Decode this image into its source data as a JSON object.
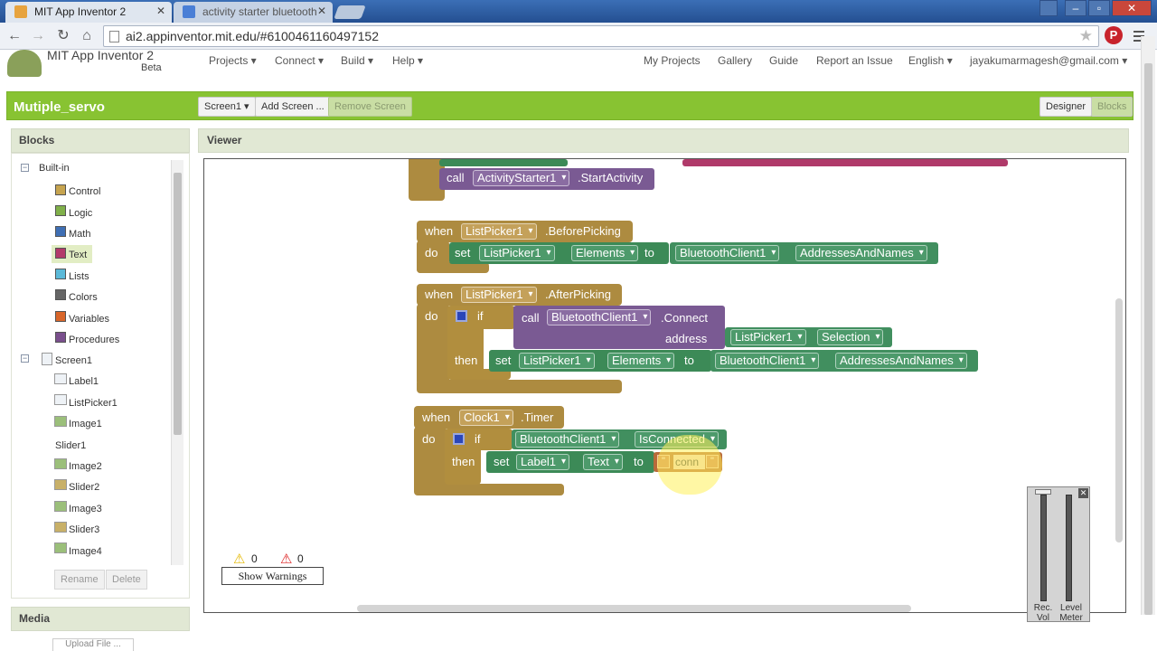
{
  "browser": {
    "tabs": [
      {
        "title": "MIT App Inventor 2",
        "active": true,
        "icon_color": "#e7a33e"
      },
      {
        "title": "activity starter bluetooth",
        "active": false,
        "icon_color": "#4a7fd6"
      }
    ],
    "url": "ai2.appinventor.mit.edu/#6100461160497152",
    "win_min": "–",
    "win_max": "▫",
    "win_close": "✕"
  },
  "app": {
    "title": "MIT App Inventor 2",
    "beta": "Beta",
    "menus": [
      "Projects ▾",
      "Connect ▾",
      "Build ▾",
      "Help ▾"
    ],
    "right_links": [
      "My Projects",
      "Gallery",
      "Guide",
      "Report an Issue",
      "English ▾",
      "jayakumarmagesh@gmail.com ▾"
    ]
  },
  "project": {
    "name": "Mutiple_servo",
    "screen_select": "Screen1 ▾",
    "add_screen": "Add Screen ...",
    "remove_screen": "Remove Screen",
    "designer": "Designer",
    "blocks": "Blocks"
  },
  "blocks_panel": {
    "title": "Blocks",
    "builtin_label": "Built-in",
    "builtin": [
      {
        "label": "Control",
        "color": "#c6a44f"
      },
      {
        "label": "Logic",
        "color": "#80b04a"
      },
      {
        "label": "Math",
        "color": "#3f6fb4"
      },
      {
        "label": "Text",
        "color": "#b33a6a"
      },
      {
        "label": "Lists",
        "color": "#5bb9d8"
      },
      {
        "label": "Colors",
        "color": "#666666"
      },
      {
        "label": "Variables",
        "color": "#d9662a"
      },
      {
        "label": "Procedures",
        "color": "#7a4f8d"
      }
    ],
    "screen_label": "Screen1",
    "components": [
      "Label1",
      "ListPicker1",
      "Image1",
      "Slider1",
      "Image2",
      "Slider2",
      "Image3",
      "Slider3",
      "Image4"
    ],
    "rename": "Rename",
    "delete": "Delete",
    "media_title": "Media",
    "upload": "Upload File ..."
  },
  "viewer": {
    "title": "Viewer",
    "block0": {
      "call": "call",
      "component": "ActivityStarter1",
      "method": ".StartActivity"
    },
    "block1": {
      "when": "when",
      "component": "ListPicker1",
      "event": ".BeforePicking",
      "do": "do",
      "set": "set",
      "target": "ListPicker1",
      "prop": "Elements",
      "to": "to",
      "src": "BluetoothClient1",
      "src_prop": "AddressesAndNames"
    },
    "block2": {
      "when": "when",
      "component": "ListPicker1",
      "event": ".AfterPicking",
      "do": "do",
      "if": "if",
      "call": "call",
      "bt": "BluetoothClient1",
      "method": ".Connect",
      "address": "address",
      "sel_comp": "ListPicker1",
      "sel_prop": "Selection",
      "then": "then",
      "set": "set",
      "target": "ListPicker1",
      "prop": "Elements",
      "to": "to",
      "src": "BluetoothClient1",
      "src_prop": "AddressesAndNames"
    },
    "block3": {
      "when": "when",
      "component": "Clock1",
      "event": ".Timer",
      "do": "do",
      "if": "if",
      "bt": "BluetoothClient1",
      "bt_prop": "IsConnected",
      "then": "then",
      "set": "set",
      "target": "Label1",
      "prop": "Text",
      "to": "to",
      "text_value": "conn"
    },
    "warnings_count": "0",
    "errors_count": "0",
    "show_warnings": "Show Warnings"
  },
  "level_meter": {
    "rec_vol": "Rec. Vol",
    "level_meter": "Level Meter"
  }
}
